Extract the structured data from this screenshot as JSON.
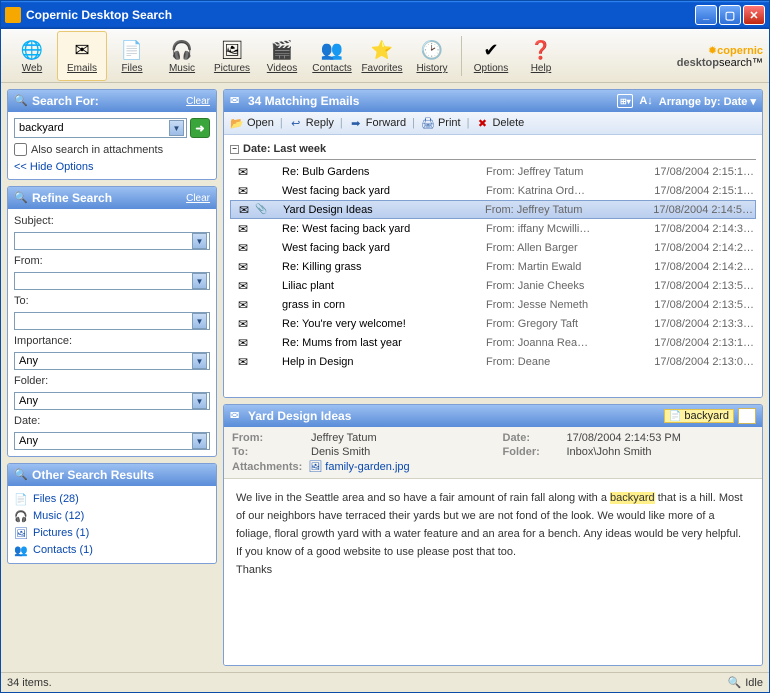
{
  "window": {
    "title": "Copernic Desktop Search"
  },
  "toolbar": {
    "items": [
      {
        "id": "web",
        "label": "Web",
        "icon": "🌐"
      },
      {
        "id": "emails",
        "label": "Emails",
        "icon": "✉",
        "selected": true
      },
      {
        "id": "files",
        "label": "Files",
        "icon": "📄"
      },
      {
        "id": "music",
        "label": "Music",
        "icon": "🎧"
      },
      {
        "id": "pictures",
        "label": "Pictures",
        "icon": "🖼"
      },
      {
        "id": "videos",
        "label": "Videos",
        "icon": "🎬"
      },
      {
        "id": "contacts",
        "label": "Contacts",
        "icon": "👥"
      },
      {
        "id": "favorites",
        "label": "Favorites",
        "icon": "⭐"
      },
      {
        "id": "history",
        "label": "History",
        "icon": "🕑"
      }
    ],
    "option_items": [
      {
        "id": "options",
        "label": "Options",
        "icon": "✔"
      },
      {
        "id": "help",
        "label": "Help",
        "icon": "❓"
      }
    ],
    "brand_top": "copernic",
    "brand_bottom_a": "desktop",
    "brand_bottom_b": "search"
  },
  "search": {
    "header": "Search For:",
    "clear": "Clear",
    "query": "backyard",
    "also_attachments": "Also search in attachments",
    "hide_options": "<< Hide Options"
  },
  "refine": {
    "header": "Refine Search",
    "clear": "Clear",
    "fields": [
      {
        "label": "Subject:",
        "value": ""
      },
      {
        "label": "From:",
        "value": ""
      },
      {
        "label": "To:",
        "value": ""
      },
      {
        "label": "Importance:",
        "value": "Any"
      },
      {
        "label": "Folder:",
        "value": "Any"
      },
      {
        "label": "Date:",
        "value": "Any"
      }
    ]
  },
  "other": {
    "header": "Other Search Results",
    "items": [
      {
        "icon": "📄",
        "label": "Files (28)"
      },
      {
        "icon": "🎧",
        "label": "Music (12)"
      },
      {
        "icon": "🖼",
        "label": "Pictures (1)"
      },
      {
        "icon": "👥",
        "label": "Contacts (1)"
      }
    ]
  },
  "results": {
    "header": "34 Matching Emails",
    "arrange_label": "Arrange by: Date",
    "actions": [
      {
        "id": "open",
        "label": "Open",
        "icon": "📂"
      },
      {
        "id": "reply",
        "label": "Reply",
        "icon": "↩"
      },
      {
        "id": "forward",
        "label": "Forward",
        "icon": "➡"
      },
      {
        "id": "print",
        "label": "Print",
        "icon": "🖨"
      },
      {
        "id": "delete",
        "label": "Delete",
        "icon": "✖"
      }
    ],
    "group": "Date: Last week",
    "rows": [
      {
        "attach": false,
        "subject": "Re: Bulb Gardens",
        "from": "From: Jeffrey Tatum",
        "date": "17/08/2004 2:15:1…",
        "selected": false
      },
      {
        "attach": false,
        "subject": "West facing back yard",
        "from": "From: Katrina Ord…",
        "date": "17/08/2004 2:15:1…",
        "selected": false
      },
      {
        "attach": true,
        "subject": "Yard Design Ideas",
        "from": "From: Jeffrey Tatum",
        "date": "17/08/2004 2:14:5…",
        "selected": true
      },
      {
        "attach": false,
        "subject": "Re: West facing back yard",
        "from": "From: iffany Mcwilli…",
        "date": "17/08/2004 2:14:3…",
        "selected": false
      },
      {
        "attach": false,
        "subject": "West facing back yard",
        "from": "From: Allen Barger",
        "date": "17/08/2004 2:14:2…",
        "selected": false
      },
      {
        "attach": false,
        "subject": "Re: Killing grass",
        "from": "From: Martin Ewald",
        "date": "17/08/2004 2:14:2…",
        "selected": false
      },
      {
        "attach": false,
        "subject": "Liliac plant",
        "from": "From: Janie Cheeks",
        "date": "17/08/2004 2:13:5…",
        "selected": false
      },
      {
        "attach": false,
        "subject": "grass in corn",
        "from": "From: Jesse Nemeth",
        "date": "17/08/2004 2:13:5…",
        "selected": false
      },
      {
        "attach": false,
        "subject": "Re: You're very welcome!",
        "from": "From: Gregory Taft",
        "date": "17/08/2004 2:13:3…",
        "selected": false
      },
      {
        "attach": false,
        "subject": "Re: Mums from last year",
        "from": "From: Joanna Rea…",
        "date": "17/08/2004 2:13:1…",
        "selected": false
      },
      {
        "attach": false,
        "subject": "Help in Design",
        "from": "From: Deane",
        "date": "17/08/2004 2:13:0…",
        "selected": false
      }
    ]
  },
  "preview": {
    "title": "Yard Design Ideas",
    "highlight_word": "backyard",
    "from_label": "From:",
    "from": "Jeffrey Tatum",
    "to_label": "To:",
    "to": "Denis Smith",
    "date_label": "Date:",
    "date": "17/08/2004 2:14:53 PM",
    "folder_label": "Folder:",
    "folder": "Inbox\\John Smith",
    "attach_label": "Attachments:",
    "attachment": "family-garden.jpg",
    "body_pre": "We live in the Seattle area and so have a fair amount of rain fall along with a ",
    "body_hl": "backyard",
    "body_post": " that is a hill. Most of our neighbors have terraced their yards but we are not fond of the look. We would like more of a foliage, floral growth yard with a water feature and an area for a bench. Any ideas would be very helpful. If you know of a good website to use please post that too.\nThanks"
  },
  "status": {
    "left": "34 items.",
    "right": "Idle"
  }
}
